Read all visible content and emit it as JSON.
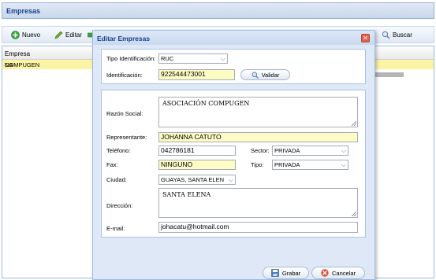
{
  "main": {
    "title": "Empresas",
    "toolbar": {
      "nuevo": "Nuevo",
      "editar": "Editar",
      "buscar": "Buscar"
    },
    "grid": {
      "column_header": "Empresa",
      "row": "COMPUGEN",
      "right_cell": "NA"
    }
  },
  "dialog": {
    "title": "Editar Empresas",
    "tipo_identificacion_label": "Tipo Identificación:",
    "tipo_identificacion_value": "RUC",
    "identificacion_label": "Identificación:",
    "identificacion_value": "922544473001",
    "validar_label": "Validar",
    "razon_social_label": "Razón Social:",
    "razon_social_value": "ASOCIACIÓN COMPUGEN",
    "representante_label": "Representante:",
    "representante_value": "JOHANNA CATUTO",
    "telefono_label": "Teléfono:",
    "telefono_value": "042786181",
    "sector_label": "Sector:",
    "sector_value": "PRIVADA",
    "fax_label": "Fax:",
    "fax_value": "NINGUNO",
    "tipo_label": "Tipo:",
    "tipo_value": "PRIVADA",
    "ciudad_label": "Ciudad:",
    "ciudad_value": "GUAYAS, SANTA ELEN",
    "direccion_label": "Dirección:",
    "direccion_value": "SANTA ELENA",
    "email_label": "E-mail:",
    "email_value": "johacatu@hotmail.com",
    "grabar_label": "Grabar",
    "cancelar_label": "Cancelar"
  },
  "colors": {
    "title_text": "#15428b",
    "highlight_yellow": "#fdfcc5",
    "row_selected": "#fbf4a5",
    "window_bg": "#dfe8f6"
  }
}
